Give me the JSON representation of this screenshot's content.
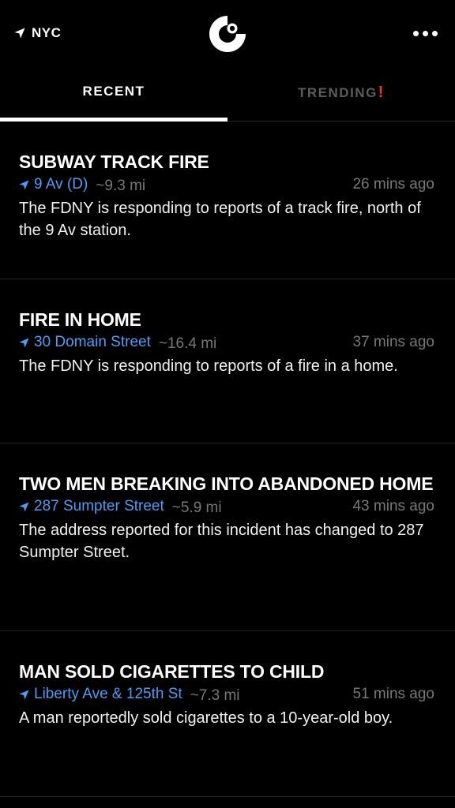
{
  "header": {
    "location": "NYC",
    "location_icon": "location-arrow-icon",
    "logo_icon": "citizen-c-logo",
    "more_icon": "more-dots-icon"
  },
  "tabs": [
    {
      "label": "RECENT",
      "active": true
    },
    {
      "label": "TRENDING",
      "active": false,
      "alert": "!"
    }
  ],
  "colors": {
    "background": "#000000",
    "link": "#4d9df3",
    "muted": "#777777",
    "alert": "#ff2d2d"
  },
  "feed": [
    {
      "title": "SUBWAY TRACK FIRE",
      "address": "9 Av (D)",
      "distance": "~9.3 mi",
      "time": "26 mins ago",
      "description": "The FDNY is responding to reports of a track fire, north of the 9 Av station."
    },
    {
      "title": "FIRE IN HOME",
      "address": "30 Domain Street",
      "distance": "~16.4 mi",
      "time": "37 mins ago",
      "description": "The FDNY is responding to reports of a fire in a home."
    },
    {
      "title": "TWO MEN BREAKING INTO ABANDONED HOME",
      "address": "287 Sumpter Street",
      "distance": "~5.9 mi",
      "time": "43 mins ago",
      "description": "The address reported for this incident has changed to 287 Sumpter Street."
    },
    {
      "title": "MAN SOLD CIGARETTES TO CHILD",
      "address": "Liberty Ave & 125th St",
      "distance": "~7.3 mi",
      "time": "51 mins ago",
      "description": "A man reportedly sold cigarettes to a 10-year-old boy."
    }
  ]
}
